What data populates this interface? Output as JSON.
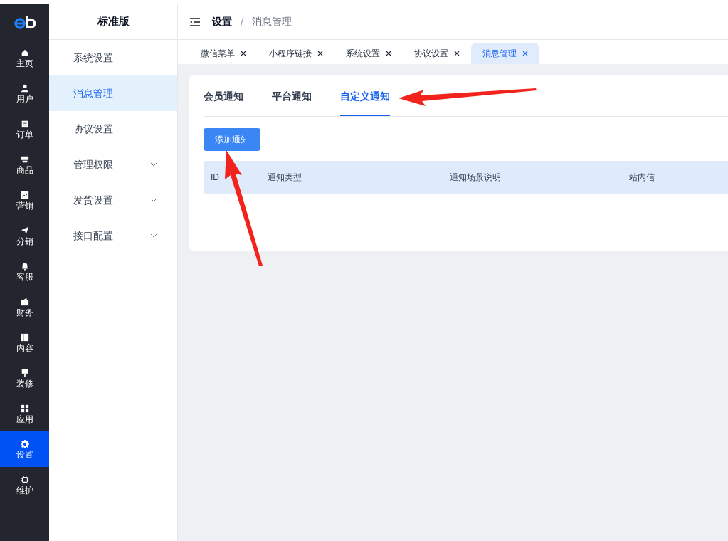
{
  "main_nav": [
    {
      "label": "主页",
      "selected": false
    },
    {
      "label": "用户",
      "selected": false
    },
    {
      "label": "订单",
      "selected": false
    },
    {
      "label": "商品",
      "selected": false
    },
    {
      "label": "营销",
      "selected": false
    },
    {
      "label": "分销",
      "selected": false
    },
    {
      "label": "客服",
      "selected": false
    },
    {
      "label": "财务",
      "selected": false
    },
    {
      "label": "内容",
      "selected": false
    },
    {
      "label": "装修",
      "selected": false
    },
    {
      "label": "应用",
      "selected": false
    },
    {
      "label": "设置",
      "selected": true
    },
    {
      "label": "维护",
      "selected": false
    }
  ],
  "sub_nav": {
    "title": "标准版",
    "items": [
      {
        "label": "系统设置",
        "selected": false,
        "expandable": false
      },
      {
        "label": "消息管理",
        "selected": true,
        "expandable": false
      },
      {
        "label": "协议设置",
        "selected": false,
        "expandable": false
      },
      {
        "label": "管理权限",
        "selected": false,
        "expandable": true
      },
      {
        "label": "发货设置",
        "selected": false,
        "expandable": true
      },
      {
        "label": "接口配置",
        "selected": false,
        "expandable": true
      }
    ]
  },
  "breadcrumb": [
    "设置",
    "消息管理"
  ],
  "breadcrumb_separator": "/",
  "page_tabs": [
    {
      "label": "微信菜单",
      "selected": false
    },
    {
      "label": "小程序链接",
      "selected": false
    },
    {
      "label": "系统设置",
      "selected": false
    },
    {
      "label": "协议设置",
      "selected": false
    },
    {
      "label": "消息管理",
      "selected": true
    }
  ],
  "content_tabs": [
    {
      "label": "会员通知",
      "selected": false
    },
    {
      "label": "平台通知",
      "selected": false
    },
    {
      "label": "自定义通知",
      "selected": true
    }
  ],
  "add_button": "添加通知",
  "table": {
    "columns": [
      "ID",
      "通知类型",
      "通知场景说明",
      "站内信"
    ]
  }
}
